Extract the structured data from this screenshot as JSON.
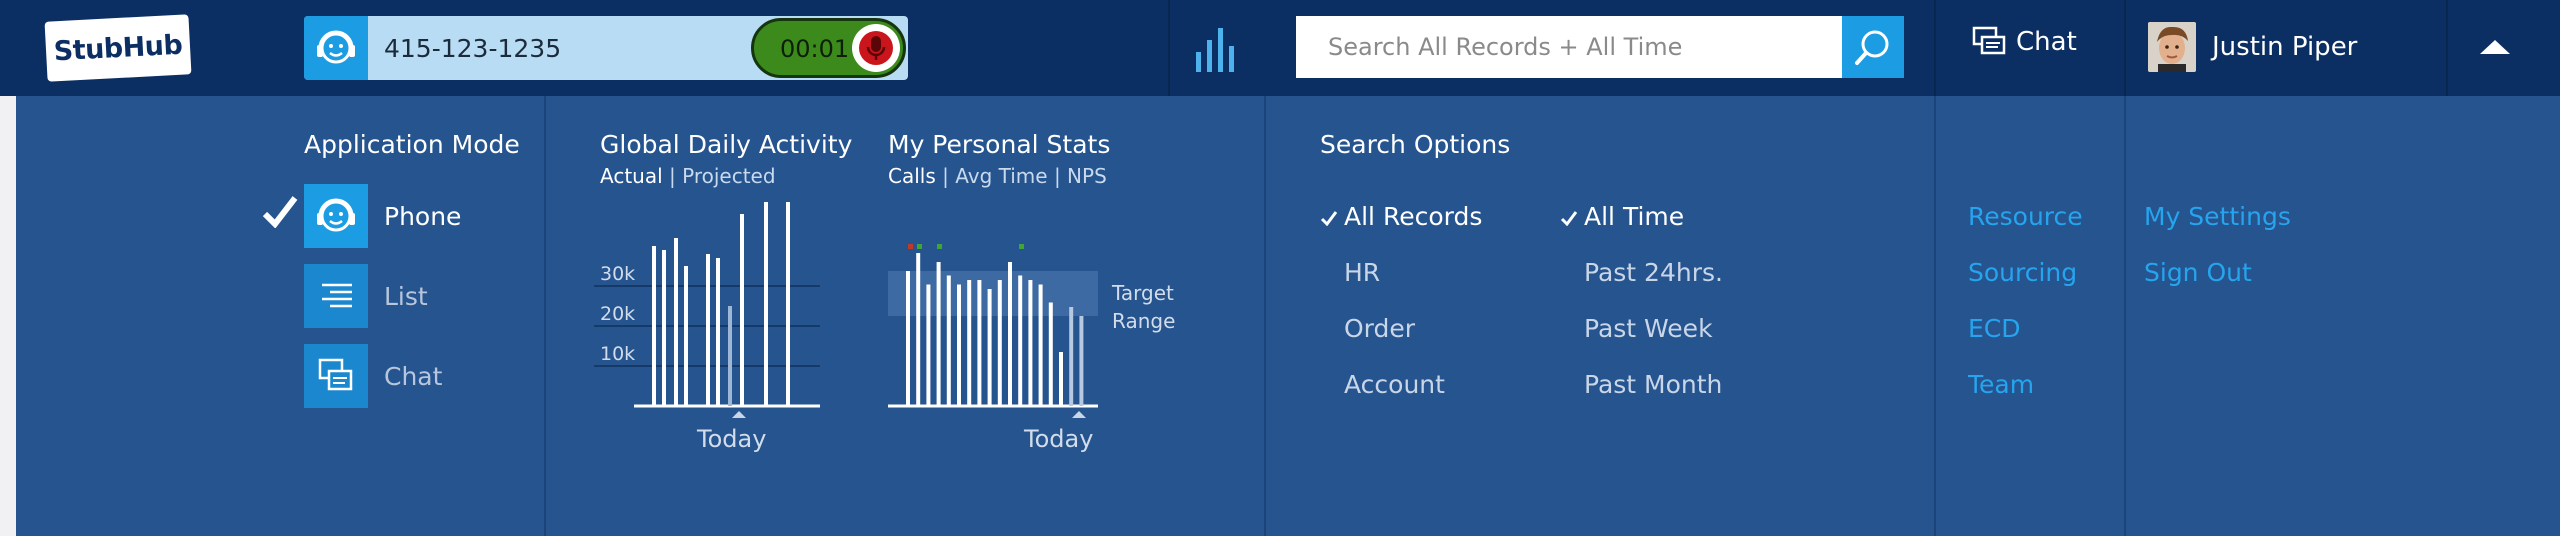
{
  "brand": {
    "logo_text": "StubHub"
  },
  "call": {
    "number": "415-123-1235",
    "timer": "00:01"
  },
  "search": {
    "placeholder": "Search All Records + All Time"
  },
  "header": {
    "chat_label": "Chat",
    "user_name": "Justin Piper"
  },
  "app_mode": {
    "title": "Application Mode",
    "modes": [
      {
        "label": "Phone",
        "selected": true
      },
      {
        "label": "List",
        "selected": false
      },
      {
        "label": "Chat",
        "selected": false
      }
    ]
  },
  "global_activity": {
    "title": "Global Daily Activity",
    "sub_actual": "Actual",
    "sub_separator": "|",
    "sub_projected": "Projected",
    "x_label": "Today"
  },
  "personal_stats": {
    "title": "My Personal Stats",
    "sub_calls": "Calls",
    "sub_sep1": "|",
    "sub_avg": "Avg Time",
    "sub_sep2": "|",
    "sub_nps": "NPS",
    "x_label": "Today",
    "target_line1": "Target",
    "target_line2": "Range"
  },
  "search_options": {
    "title": "Search Options",
    "records": [
      "All Records",
      "HR",
      "Order",
      "Account"
    ],
    "times": [
      "All Time",
      "Past 24hrs.",
      "Past Week",
      "Past Month"
    ]
  },
  "links_col1": [
    "Resource",
    "Sourcing",
    "ECD",
    "Team"
  ],
  "links_col2": [
    "My Settings",
    "Sign Out"
  ],
  "chart_data": [
    {
      "type": "bar",
      "title": "Global Daily Activity",
      "xlabel": "Today",
      "ylabel": "",
      "yticks": [
        "10k",
        "20k",
        "30k"
      ],
      "ylim": [
        0,
        52
      ],
      "values": [
        40,
        39,
        42,
        35,
        38,
        37,
        25,
        48,
        51,
        51
      ],
      "projected_index": 6
    },
    {
      "type": "bar",
      "title": "My Personal Stats",
      "xlabel": "Today",
      "values": [
        30,
        34,
        27,
        32,
        29,
        27,
        28,
        28,
        26,
        28,
        32,
        29,
        28,
        27,
        23,
        12,
        22,
        20
      ],
      "target_range": [
        20,
        30
      ],
      "today_index": 16
    }
  ]
}
